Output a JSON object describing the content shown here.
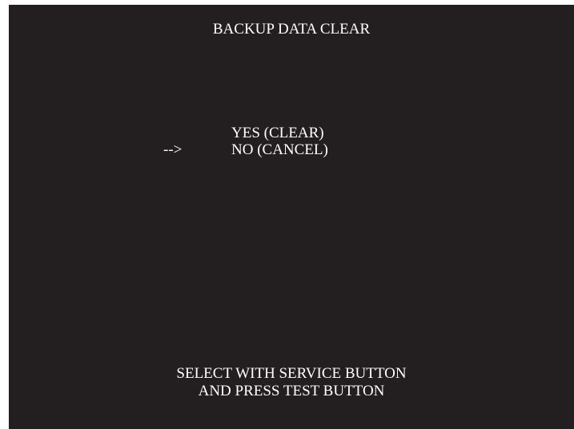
{
  "screen": {
    "title": "BACKUP DATA CLEAR",
    "cursor": "-->",
    "options": [
      {
        "label": "YES (CLEAR)"
      },
      {
        "label": "NO (CANCEL)"
      }
    ],
    "selected_option": "NO (CANCEL)",
    "instructions": [
      "SELECT WITH SERVICE BUTTON",
      "AND PRESS TEST BUTTON"
    ]
  },
  "colors": {
    "background": "#231f20",
    "text": "#ffffff",
    "border": "#ffffff"
  }
}
